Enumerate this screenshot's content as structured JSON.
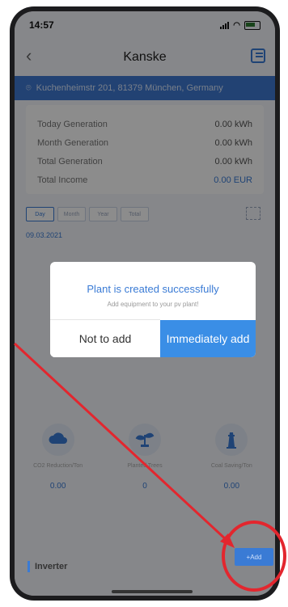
{
  "status": {
    "time": "14:57"
  },
  "nav": {
    "title": "Kanske"
  },
  "address": {
    "text": "Kuchenheimstr 201, 81379 München, Germany"
  },
  "summary": [
    {
      "label": "Today Generation",
      "value": "0.00 kWh"
    },
    {
      "label": "Month Generation",
      "value": "0.00 kWh"
    },
    {
      "label": "Total Generation",
      "value": "0.00 kWh"
    },
    {
      "label": "Total Income",
      "value": "0.00 EUR"
    }
  ],
  "tabs": [
    "Day",
    "Month",
    "Year",
    "Total"
  ],
  "date": "09.03.2021",
  "dialog": {
    "title": "Plant is created successfully",
    "subtitle": "Add equipment to your pv plant!",
    "no_label": "Not to add",
    "yes_label": "Immediately add"
  },
  "stats": [
    {
      "label": "CO2 Reduction/Ton",
      "value": "0.00",
      "icon": "cloud-icon"
    },
    {
      "label": "Planted Trees",
      "value": "0",
      "icon": "tree-icon"
    },
    {
      "label": "Coal Saving/Ton",
      "value": "0.00",
      "icon": "lighthouse-icon"
    }
  ],
  "inverter": {
    "label": "Inverter"
  },
  "add_button": {
    "label": "+Add"
  },
  "colors": {
    "accent": "#3a7bd5",
    "annotation": "#e3262e"
  }
}
